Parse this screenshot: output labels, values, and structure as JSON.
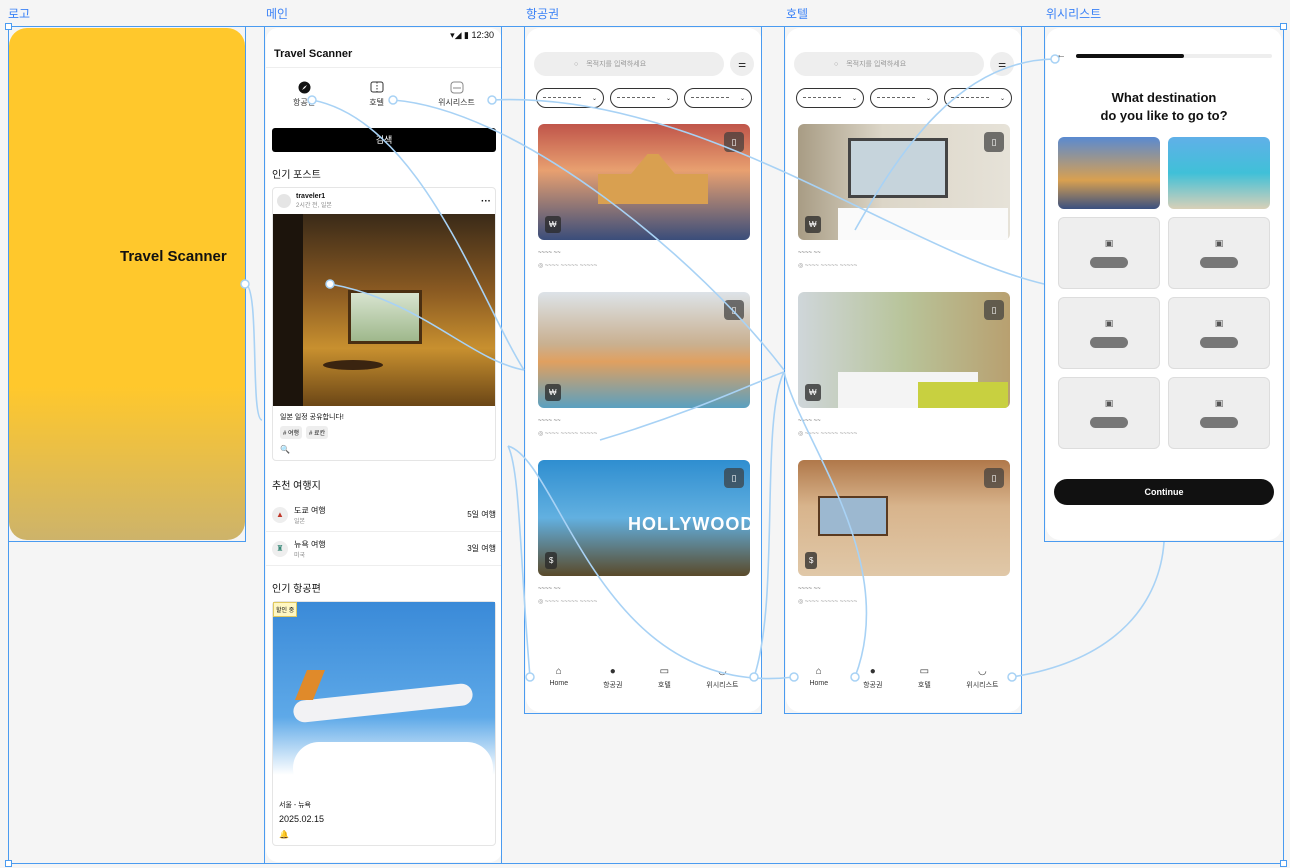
{
  "frame_labels": {
    "logo": "로고",
    "main": "메인",
    "flights": "항공권",
    "hotels": "호텔",
    "wishlist": "위시리스트"
  },
  "logo": {
    "title": "Travel Scanner"
  },
  "main": {
    "status_time": "12:30",
    "app_title": "Travel Scanner",
    "categories": [
      {
        "label": "항공권",
        "icon": "compass-icon"
      },
      {
        "label": "호텔",
        "icon": "ticket-icon"
      },
      {
        "label": "위시리스트",
        "icon": "wishlist-icon"
      }
    ],
    "search_label": "검색",
    "popular_posts_title": "인기 포스트",
    "post": {
      "user": "traveler1",
      "meta": "2시간 전, 일본",
      "caption": "일본 일정 공유합니다!",
      "tags": [
        "# 여행",
        "# 료칸"
      ]
    },
    "recommended_title": "추천 여행지",
    "recommended": [
      {
        "name": "도쿄 여행",
        "country": "일본",
        "duration": "5일 여행"
      },
      {
        "name": "뉴욕 여행",
        "country": "미국",
        "duration": "3일 여행"
      }
    ],
    "popular_flights_title": "인기 항공편",
    "flight": {
      "badge": "할인 중",
      "route": "서울 - 뉴욕",
      "date": "2025.02.15"
    }
  },
  "search": {
    "placeholder": "목적지를 입력하세요"
  },
  "flight_cards": [
    {
      "price": "₩",
      "colors": [
        "#c0554a",
        "#3a4d7a"
      ]
    },
    {
      "price": "₩",
      "colors": [
        "#c9d2d8",
        "#5aa0c0"
      ]
    },
    {
      "price": "$",
      "colors": [
        "#2f8ed0",
        "#5a4a2a"
      ]
    }
  ],
  "hotel_cards": [
    {
      "price": "₩",
      "colors": [
        "#c9c3b4",
        "#e8e2d4"
      ]
    },
    {
      "price": "₩",
      "colors": [
        "#d4d8d0",
        "#b8a070"
      ]
    },
    {
      "price": "$",
      "colors": [
        "#b0784a",
        "#e0c8a8"
      ]
    }
  ],
  "tabs": [
    "Home",
    "항공권",
    "호텔",
    "위시리스트"
  ],
  "wishlist": {
    "question_line1": "What destination",
    "question_line2": "do you like to go to?",
    "progress": 0.55,
    "continue_label": "Continue"
  }
}
